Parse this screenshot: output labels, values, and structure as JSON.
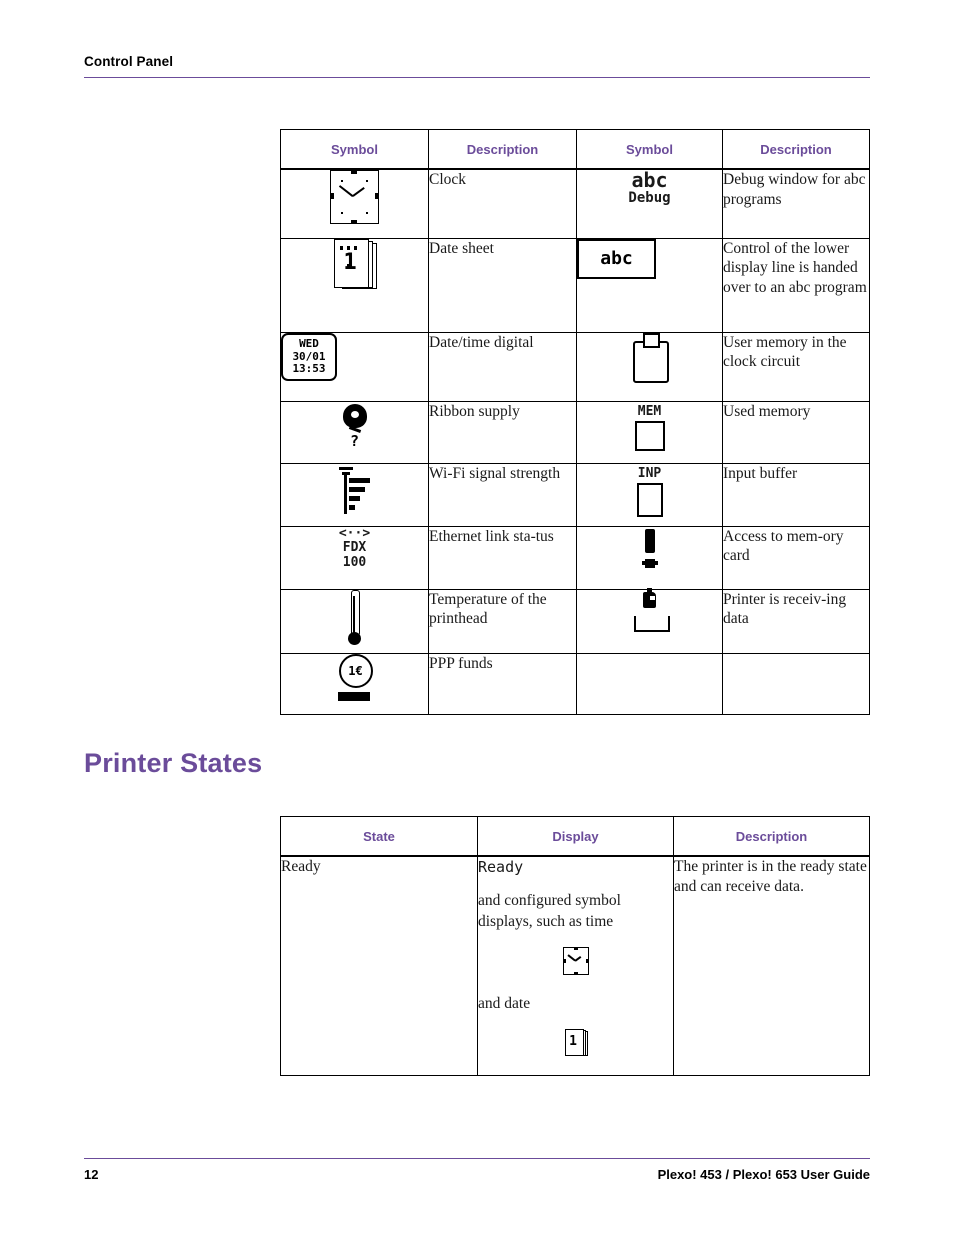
{
  "header": {
    "title": "Control Panel"
  },
  "symbol_table": {
    "headers": [
      "Symbol",
      "Description",
      "Symbol",
      "Description"
    ],
    "rows": [
      {
        "left_icon": "clock-icon",
        "left_desc": "Clock",
        "right_icon": "abc-debug-icon",
        "right_icon_text": {
          "big": "abc",
          "sub": "Debug"
        },
        "right_desc": "Debug window for abc programs"
      },
      {
        "left_icon": "date-sheet-icon",
        "left_icon_text": "1",
        "left_desc": "Date sheet",
        "right_icon": "abc-box-icon",
        "right_icon_text": "abc",
        "right_desc": "Control of the lower display line is handed over to an abc program"
      },
      {
        "left_icon": "digital-datetime-icon",
        "left_icon_text": {
          "line1": "WED",
          "line2": "30/01",
          "line3": "13:53"
        },
        "left_desc": "Date/time digital",
        "right_icon": "clipboard-icon",
        "right_desc": "User memory in the clock circuit"
      },
      {
        "left_icon": "ribbon-supply-icon",
        "left_icon_text": "?",
        "left_desc": "Ribbon supply",
        "right_icon": "used-memory-icon",
        "right_icon_text": "MEM",
        "right_desc": "Used memory"
      },
      {
        "left_icon": "wifi-signal-icon",
        "left_desc": "Wi-Fi signal strength",
        "right_icon": "input-buffer-icon",
        "right_icon_text": "INP",
        "right_desc": "Input buffer"
      },
      {
        "left_icon": "ethernet-link-icon",
        "left_icon_text": {
          "arrows": "<··>",
          "line1": "FDX",
          "line2": "100"
        },
        "left_desc": "Ethernet link sta-tus",
        "right_icon": "memory-card-access-icon",
        "right_desc": "Access to mem-ory card"
      },
      {
        "left_icon": "thermometer-icon",
        "left_desc": "Temperature of the printhead",
        "right_icon": "receiving-data-icon",
        "right_desc": "Printer is receiv-ing data"
      },
      {
        "left_icon": "ppp-funds-icon",
        "left_icon_text": "1€",
        "left_desc": "PPP funds",
        "right_icon": "",
        "right_desc": ""
      }
    ]
  },
  "section": {
    "heading": "Printer States"
  },
  "states_table": {
    "headers": [
      "State",
      "Display",
      "Description"
    ],
    "rows": [
      {
        "state": "Ready",
        "display_mono": "Ready",
        "display_text_1": "and configured symbol displays, such as time",
        "display_icon_1": "clock-icon",
        "display_text_2": "and date",
        "display_icon_2": "date-sheet-icon",
        "display_icon_2_text": "1",
        "description": "The printer is in the ready state and can receive data."
      }
    ]
  },
  "footer": {
    "page_number": "12",
    "guide_title": "Plexo! 453 / Plexo! 653 User Guide"
  },
  "colors": {
    "accent": "#6b4c9a",
    "text": "#1a1a1a"
  }
}
